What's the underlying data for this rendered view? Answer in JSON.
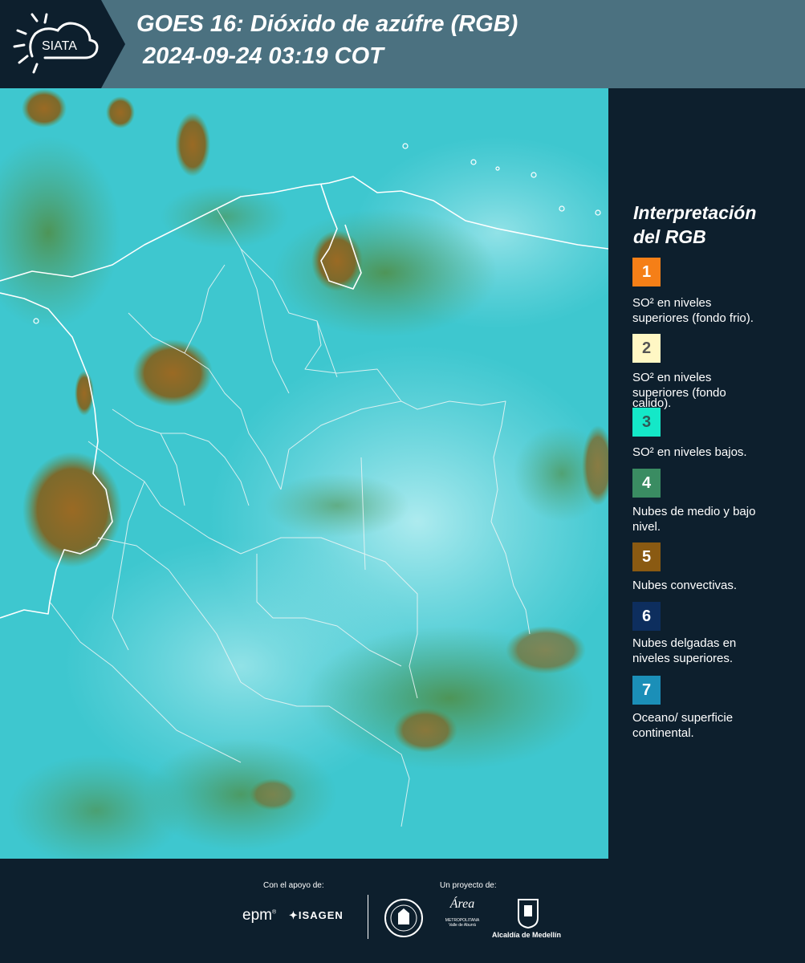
{
  "header": {
    "logo_text": "SIATA",
    "title_line1": "GOES 16: Dióxido de azúfre (RGB)",
    "title_line2": "2024-09-24 03:19 COT"
  },
  "legend": {
    "title_line1": "Interpretación",
    "title_line2": "del RGB",
    "items": [
      {
        "number": "1",
        "color": "#f57f17",
        "text_color": "#ffffff",
        "line1": "SO² en niveles",
        "line2": "superiores (fondo frio)."
      },
      {
        "number": "2",
        "color": "#fff7c4",
        "text_color": "#555555",
        "line1": "SO² en niveles",
        "line2": "superiores (fondo",
        "line3": "calido)."
      },
      {
        "number": "3",
        "color": "#14e8c8",
        "text_color": "#2e5a55",
        "line1": "SO² en niveles bajos."
      },
      {
        "number": "4",
        "color": "#3a8c62",
        "text_color": "#ffffff",
        "line1": "Nubes de medio y bajo",
        "line2": "nivel."
      },
      {
        "number": "5",
        "color": "#8a5a12",
        "text_color": "#ffffff",
        "line1": "Nubes convectivas."
      },
      {
        "number": "6",
        "color": "#0d2e5e",
        "text_color": "#ffffff",
        "line1": "Nubes delgadas en",
        "line2": "niveles superiores."
      },
      {
        "number": "7",
        "color": "#1b8fb8",
        "text_color": "#ffffff",
        "line1": "Oceano/ superficie",
        "line2": "continental."
      }
    ]
  },
  "footer": {
    "support_label": "Con el apoyo de:",
    "project_label": "Un proyecto de:",
    "epm": "epm",
    "isagen": "ISAGEN",
    "metro_main": "Área",
    "metro_sub1": "METROPOLITANA",
    "metro_sub2": "Valle de Aburrá",
    "alcaldia": "Alcaldía de Medellín"
  }
}
